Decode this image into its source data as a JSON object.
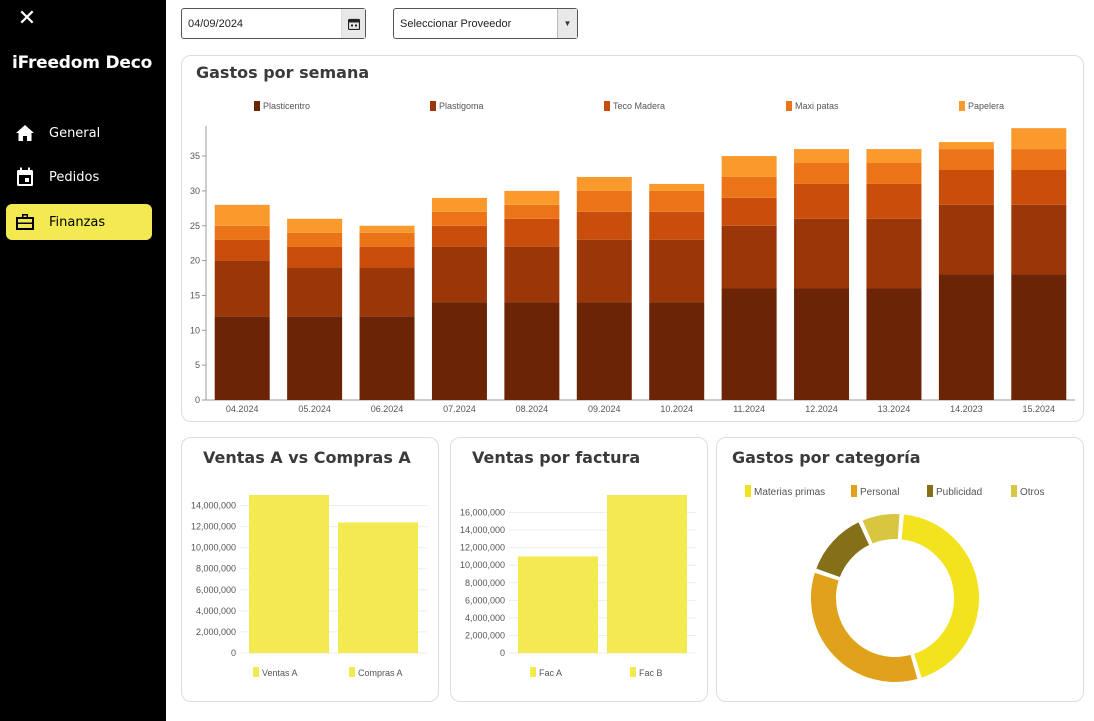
{
  "sidebar": {
    "brand": "iFreedom Deco",
    "items": [
      {
        "label": "General",
        "icon": "home-icon",
        "active": false
      },
      {
        "label": "Pedidos",
        "icon": "calendar-icon",
        "active": false
      },
      {
        "label": "Finanzas",
        "icon": "briefcase-icon",
        "active": true
      }
    ]
  },
  "filters": {
    "date_value": "04/09/2024",
    "provider_value": "Seleccionar Proveedor"
  },
  "colors": {
    "accent": "#f2ea50",
    "series": [
      "#6b2506",
      "#9a3608",
      "#c94e0c",
      "#eb7419",
      "#fb9a2c"
    ],
    "category": [
      "#f3e31f",
      "#e0a21b",
      "#85701a",
      "#d9c640"
    ]
  },
  "cards": {
    "weekly": {
      "title": "Gastos por semana"
    },
    "ventas_compras": {
      "title": "Ventas A vs Compras A"
    },
    "ventas_factura": {
      "title": "Ventas por factura"
    },
    "categoria": {
      "title": "Gastos por categoría"
    }
  },
  "chart_data": [
    {
      "type": "bar",
      "stacked": true,
      "title": "Gastos por semana",
      "categories": [
        "04.2024",
        "05.2024",
        "06.2024",
        "07.2024",
        "08.2024",
        "09.2024",
        "10.2024",
        "11.2024",
        "12.2024",
        "13.2024",
        "14.2023",
        "15.2024"
      ],
      "series": [
        {
          "name": "Plasticentro",
          "values": [
            12,
            12,
            12,
            14,
            14,
            14,
            14,
            16,
            16,
            16,
            18,
            18
          ]
        },
        {
          "name": "Plastigoma",
          "values": [
            8,
            7,
            7,
            8,
            8,
            9,
            9,
            9,
            10,
            10,
            10,
            10
          ]
        },
        {
          "name": "Teco Madera",
          "values": [
            3,
            3,
            3,
            3,
            4,
            4,
            4,
            4,
            5,
            5,
            5,
            5
          ]
        },
        {
          "name": "Maxi patas",
          "values": [
            2,
            2,
            2,
            2,
            2,
            3,
            3,
            3,
            3,
            3,
            3,
            3
          ]
        },
        {
          "name": "Papelera",
          "values": [
            3,
            2,
            1,
            2,
            2,
            2,
            1,
            3,
            2,
            2,
            1,
            3
          ]
        }
      ],
      "yticks": [
        0,
        5,
        10,
        15,
        20,
        25,
        30,
        35
      ],
      "ylim": [
        0,
        39
      ],
      "legend": "top"
    },
    {
      "type": "bar",
      "title": "Ventas A vs Compras A",
      "categories": [
        "Ventas A",
        "Compras A"
      ],
      "values": [
        15000000,
        12400000
      ],
      "yticks": [
        "0",
        "2,000,000",
        "4,000,000",
        "6,000,000",
        "8,000,000",
        "10,000,000",
        "12,000,000",
        "14,000,000"
      ],
      "ylim": [
        0,
        15000000
      ],
      "legend": "bottom"
    },
    {
      "type": "bar",
      "title": "Ventas por factura",
      "categories": [
        "Fac A",
        "Fac B"
      ],
      "values": [
        11000000,
        18000000
      ],
      "yticks": [
        "0",
        "2,000,000",
        "4,000,000",
        "6,000,000",
        "8,000,000",
        "10,000,000",
        "12,000,000",
        "14,000,000",
        "16,000,000"
      ],
      "ylim": [
        0,
        18000000
      ],
      "legend": "bottom"
    },
    {
      "type": "pie",
      "donut": true,
      "title": "Gastos por categoría",
      "categories": [
        "Materias primas",
        "Personal",
        "Publicidad",
        "Otros"
      ],
      "values": [
        44,
        35,
        13,
        8
      ],
      "legend": "top"
    }
  ]
}
